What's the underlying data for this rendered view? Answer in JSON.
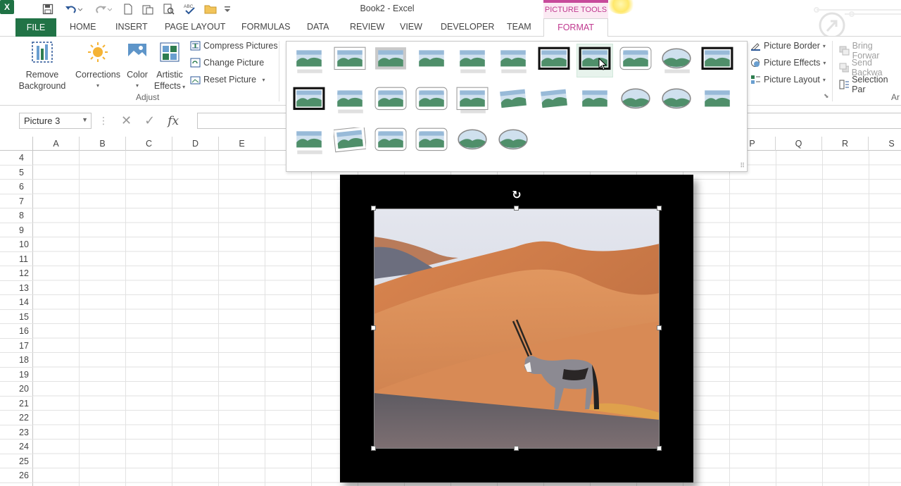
{
  "window": {
    "title": "Book2 - Excel",
    "contextual_group": "PICTURE TOOLS"
  },
  "quick_access": [
    "save-icon",
    "undo-icon",
    "redo-icon",
    "new-icon",
    "paste-icon",
    "print-preview-icon",
    "spelling-icon",
    "open-icon",
    "customize-icon"
  ],
  "tabs": {
    "file": "FILE",
    "home": "HOME",
    "insert": "INSERT",
    "page_layout": "PAGE LAYOUT",
    "formulas": "FORMULAS",
    "data": "DATA",
    "review": "REVIEW",
    "view": "VIEW",
    "developer": "DEVELOPER",
    "team": "TEAM",
    "format": "FORMAT"
  },
  "ribbon": {
    "remove_background": {
      "line1": "Remove",
      "line2": "Background"
    },
    "corrections": "Corrections",
    "color": "Color",
    "artistic_effects": {
      "line1": "Artistic",
      "line2": "Effects"
    },
    "compress_pictures": "Compress Pictures",
    "change_picture": "Change Picture",
    "reset_picture": "Reset Picture",
    "adjust_group": "Adjust",
    "picture_border": "Picture Border",
    "picture_effects": "Picture Effects",
    "picture_layout": "Picture Layout",
    "bring_forward": "Bring Forwar",
    "send_backward": "Send Backwa",
    "selection_pane": "Selection Par",
    "arrange_group_partial": "Ar"
  },
  "formula_bar": {
    "name_box": "Picture 3",
    "fx": "fx",
    "value": ""
  },
  "columns": [
    "A",
    "B",
    "C",
    "D",
    "E",
    "P",
    "Q",
    "R",
    "S"
  ],
  "rows": [
    "4",
    "5",
    "6",
    "7",
    "8",
    "9",
    "10",
    "11",
    "12",
    "13",
    "14",
    "15",
    "16",
    "17",
    "18",
    "19",
    "20",
    "21",
    "22",
    "23",
    "24",
    "25",
    "26"
  ],
  "picture_styles_gallery": {
    "rows": 3,
    "count": 28,
    "hovered_index": 7
  },
  "colors": {
    "excel_green": "#217346",
    "picture_tools_accent": "#c0398f",
    "picture_frame": "#000000"
  }
}
